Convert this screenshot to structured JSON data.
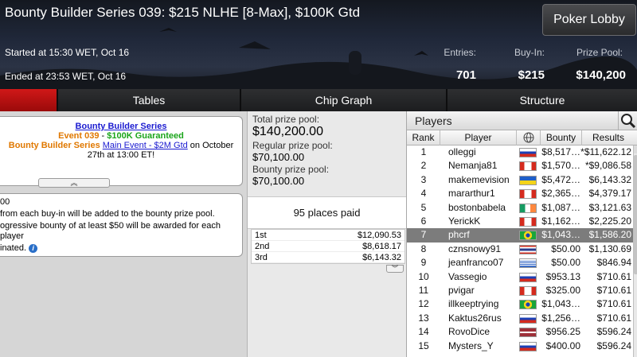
{
  "header": {
    "title": "Bounty Builder Series 039: $215 NLHE [8-Max], $100K Gtd",
    "lobby_button": "Poker Lobby",
    "started": "Started at 15:30 WET, Oct 16",
    "ended": "Ended at 23:53 WET, Oct 16",
    "entries_label": "Entries:",
    "entries": "701",
    "buyin_label": "Buy-In:",
    "buyin": "$215",
    "prize_label": "Prize Pool:",
    "prize": "$140,200"
  },
  "tabs": [
    {
      "label": ""
    },
    {
      "label": "Tables"
    },
    {
      "label": "Chip Graph"
    },
    {
      "label": "Structure"
    }
  ],
  "promo": {
    "line1": "Bounty Builder Series",
    "event": "Event 039",
    "dash": " - ",
    "guarantee": "$100K Guaranteed",
    "series": "Bounty Builder Series",
    "main_event_link": "Main Event - $2M Gtd",
    "rest": " on October 27th at 13:00 ET!",
    "collapse": "︽"
  },
  "bounty_info": {
    "line1": "00",
    "line2": "from each buy-in will be added to the bounty prize pool.",
    "line3": "ogressive bounty of at least $50 will be awarded for each player",
    "line4": "inated."
  },
  "pools": {
    "total_label": "Total prize pool:",
    "total": "$140,200.00",
    "regular_label": "Regular prize pool:",
    "regular": "$70,100.00",
    "bounty_label": "Bounty prize pool:",
    "bounty": "$70,100.00",
    "places": "95 places paid"
  },
  "payouts": [
    {
      "place": "1st",
      "amount": "$12,090.53"
    },
    {
      "place": "2nd",
      "amount": "$8,618.17"
    },
    {
      "place": "3rd",
      "amount": "$6,143.32"
    }
  ],
  "players": {
    "title": "Players",
    "columns": {
      "rank": "Rank",
      "player": "Player",
      "bounty": "Bounty",
      "results": "Results"
    },
    "rows": [
      {
        "rank": "1",
        "name": "olleggi",
        "flag": "ru",
        "bounty": "$8,517…",
        "result": "*$11,622.12"
      },
      {
        "rank": "2",
        "name": "Nemanja81",
        "flag": "ca",
        "bounty": "$1,570…",
        "result": "*$9,086.58"
      },
      {
        "rank": "3",
        "name": "makemevision",
        "flag": "ua",
        "bounty": "$5,472…",
        "result": "$6,143.32"
      },
      {
        "rank": "4",
        "name": "mararthur1",
        "flag": "ca",
        "bounty": "$2,365…",
        "result": "$4,379.17"
      },
      {
        "rank": "5",
        "name": "bostonbabela",
        "flag": "ie",
        "bounty": "$1,087…",
        "result": "$3,121.63"
      },
      {
        "rank": "6",
        "name": "YerickK",
        "flag": "ca",
        "bounty": "$1,162…",
        "result": "$2,225.20"
      },
      {
        "rank": "7",
        "name": "phcrf",
        "flag": "br",
        "bounty": "$1,043…",
        "result": "$1,586.20"
      },
      {
        "rank": "8",
        "name": "cznsnowy91",
        "flag": "th",
        "bounty": "$50.00",
        "result": "$1,130.69"
      },
      {
        "rank": "9",
        "name": "jeanfranco07",
        "flag": "uy",
        "bounty": "$50.00",
        "result": "$846.94"
      },
      {
        "rank": "10",
        "name": "Vassegio",
        "flag": "ru",
        "bounty": "$953.13",
        "result": "$710.61"
      },
      {
        "rank": "11",
        "name": "pvigar",
        "flag": "ca",
        "bounty": "$325.00",
        "result": "$710.61"
      },
      {
        "rank": "12",
        "name": "illkeeptrying",
        "flag": "br",
        "bounty": "$1,043…",
        "result": "$710.61"
      },
      {
        "rank": "13",
        "name": "Kaktus26rus",
        "flag": "ru",
        "bounty": "$1,256…",
        "result": "$710.61"
      },
      {
        "rank": "14",
        "name": "RovoDice",
        "flag": "lv",
        "bounty": "$956.25",
        "result": "$596.24"
      },
      {
        "rank": "15",
        "name": "Mysters_Y",
        "flag": "ru",
        "bounty": "$400.00",
        "result": "$596.24"
      }
    ],
    "selected_index": 6
  },
  "colors": {
    "accent_red": "#c41212",
    "selected_row": "#7c7c7c"
  }
}
